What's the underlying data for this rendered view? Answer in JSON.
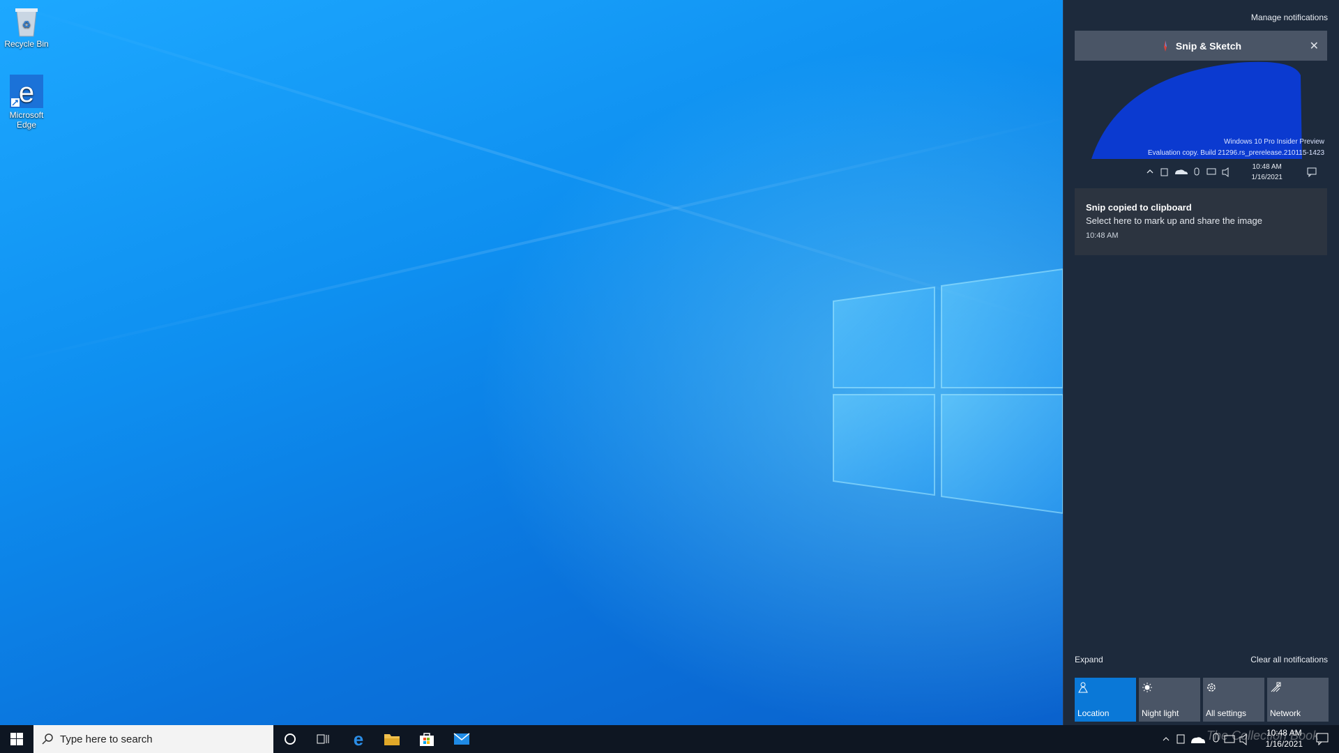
{
  "desktop": {
    "icons": [
      {
        "label": "Recycle Bin"
      },
      {
        "label": "Microsoft\nEdge"
      }
    ]
  },
  "taskbar": {
    "search_placeholder": "Type here to search",
    "tray_time": "10:48 AM",
    "tray_date": "1/16/2021"
  },
  "action_center": {
    "manage_label": "Manage notifications",
    "group_title": "Snip & Sketch",
    "thumbnail": {
      "watermark_line1": "Windows 10 Pro Insider Preview",
      "watermark_line2": "Evaluation copy. Build 21296.rs_prerelease.210115-1423",
      "time": "10:48 AM",
      "date": "1/16/2021"
    },
    "toast": {
      "title": "Snip copied to clipboard",
      "body": "Select here to mark up and share the image",
      "time": "10:48 AM"
    },
    "expand_label": "Expand",
    "clear_label": "Clear all notifications",
    "quick_actions": [
      {
        "label": "Location",
        "icon": "location-icon",
        "active": true
      },
      {
        "label": "Night light",
        "icon": "night-light-icon",
        "active": false
      },
      {
        "label": "All settings",
        "icon": "settings-icon",
        "active": false
      },
      {
        "label": "Network",
        "icon": "network-icon",
        "active": false
      }
    ],
    "colors": {
      "active_tile": "#0a78d7",
      "tile": "#4a5566",
      "panel": "#1d2a3c"
    }
  },
  "watermark": "The Collection Book"
}
